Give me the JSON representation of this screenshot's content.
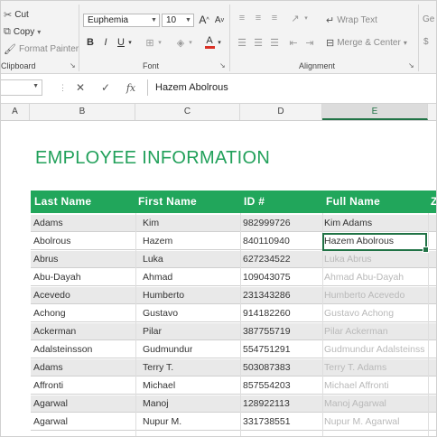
{
  "ribbon": {
    "clipboard": {
      "cut_label": "Cut",
      "copy_label": "Copy",
      "copy_dd": "▾",
      "format_painter_label": "Format Painter",
      "group_label": "Clipboard",
      "launcher": "↘"
    },
    "font": {
      "font_name": "Euphemia",
      "font_size": "10",
      "grow_label": "A",
      "shrink_label": "A",
      "bold_label": "B",
      "italic_label": "I",
      "underline_label": "U",
      "font_color_label": "A",
      "group_label": "Font",
      "launcher": "↘",
      "font_color": "#d93025"
    },
    "alignment": {
      "wrap_text_label": "Wrap Text",
      "merge_center_label": "Merge & Center",
      "merge_dd": "▾",
      "group_label": "Alignment",
      "launcher": "↘"
    },
    "number": {
      "format_partial": "Ge"
    }
  },
  "formula_bar": {
    "name_box": "",
    "cancel": "✕",
    "enter": "✓",
    "fx": "fx",
    "content": "Hazem Abolrous"
  },
  "columns": [
    "A",
    "B",
    "C",
    "D",
    "E"
  ],
  "selected_column": "E",
  "sheet": {
    "title": "EMPLOYEE INFORMATION",
    "headers": [
      "Last  Name",
      "First  Name",
      "ID  #",
      "Full  Name",
      "Z"
    ],
    "rows": [
      {
        "last": "Adams",
        "first": "Kim",
        "id": "982999726",
        "full": "Kim  Adams"
      },
      {
        "last": "Abolrous",
        "first": "Hazem",
        "id": "840110940",
        "full": "Hazem  Abolrous"
      },
      {
        "last": "Abrus",
        "first": "Luka",
        "id": "627234522",
        "full": "Luka  Abrus"
      },
      {
        "last": "Abu-Dayah",
        "first": "Ahmad",
        "id": "109043075",
        "full": "Ahmad  Abu-Dayah"
      },
      {
        "last": "Acevedo",
        "first": "Humberto",
        "id": "231343286",
        "full": "Humberto  Acevedo"
      },
      {
        "last": "Achong",
        "first": "Gustavo",
        "id": "914182260",
        "full": "Gustavo  Achong"
      },
      {
        "last": "Ackerman",
        "first": "Pilar",
        "id": "387755719",
        "full": "Pilar  Ackerman"
      },
      {
        "last": "Adalsteinsson",
        "first": "Gudmundur",
        "id": "554751291",
        "full": "Gudmundur  Adalsteinss"
      },
      {
        "last": "Adams",
        "first": "Terry  T.",
        "id": "503087383",
        "full": "Terry  T.  Adams"
      },
      {
        "last": "Affronti",
        "first": "Michael",
        "id": "857554203",
        "full": "Michael  Affronti"
      },
      {
        "last": "Agarwal",
        "first": "Manoj",
        "id": "128922113",
        "full": "Manoj  Agarwal"
      },
      {
        "last": "Agarwal",
        "first": "Nupur  M.",
        "id": "331738551",
        "full": "Nupur  M.  Agarwal"
      }
    ]
  },
  "colors": {
    "accent": "#217346",
    "header_fill": "#21a65b",
    "title_color": "#21a05a"
  }
}
